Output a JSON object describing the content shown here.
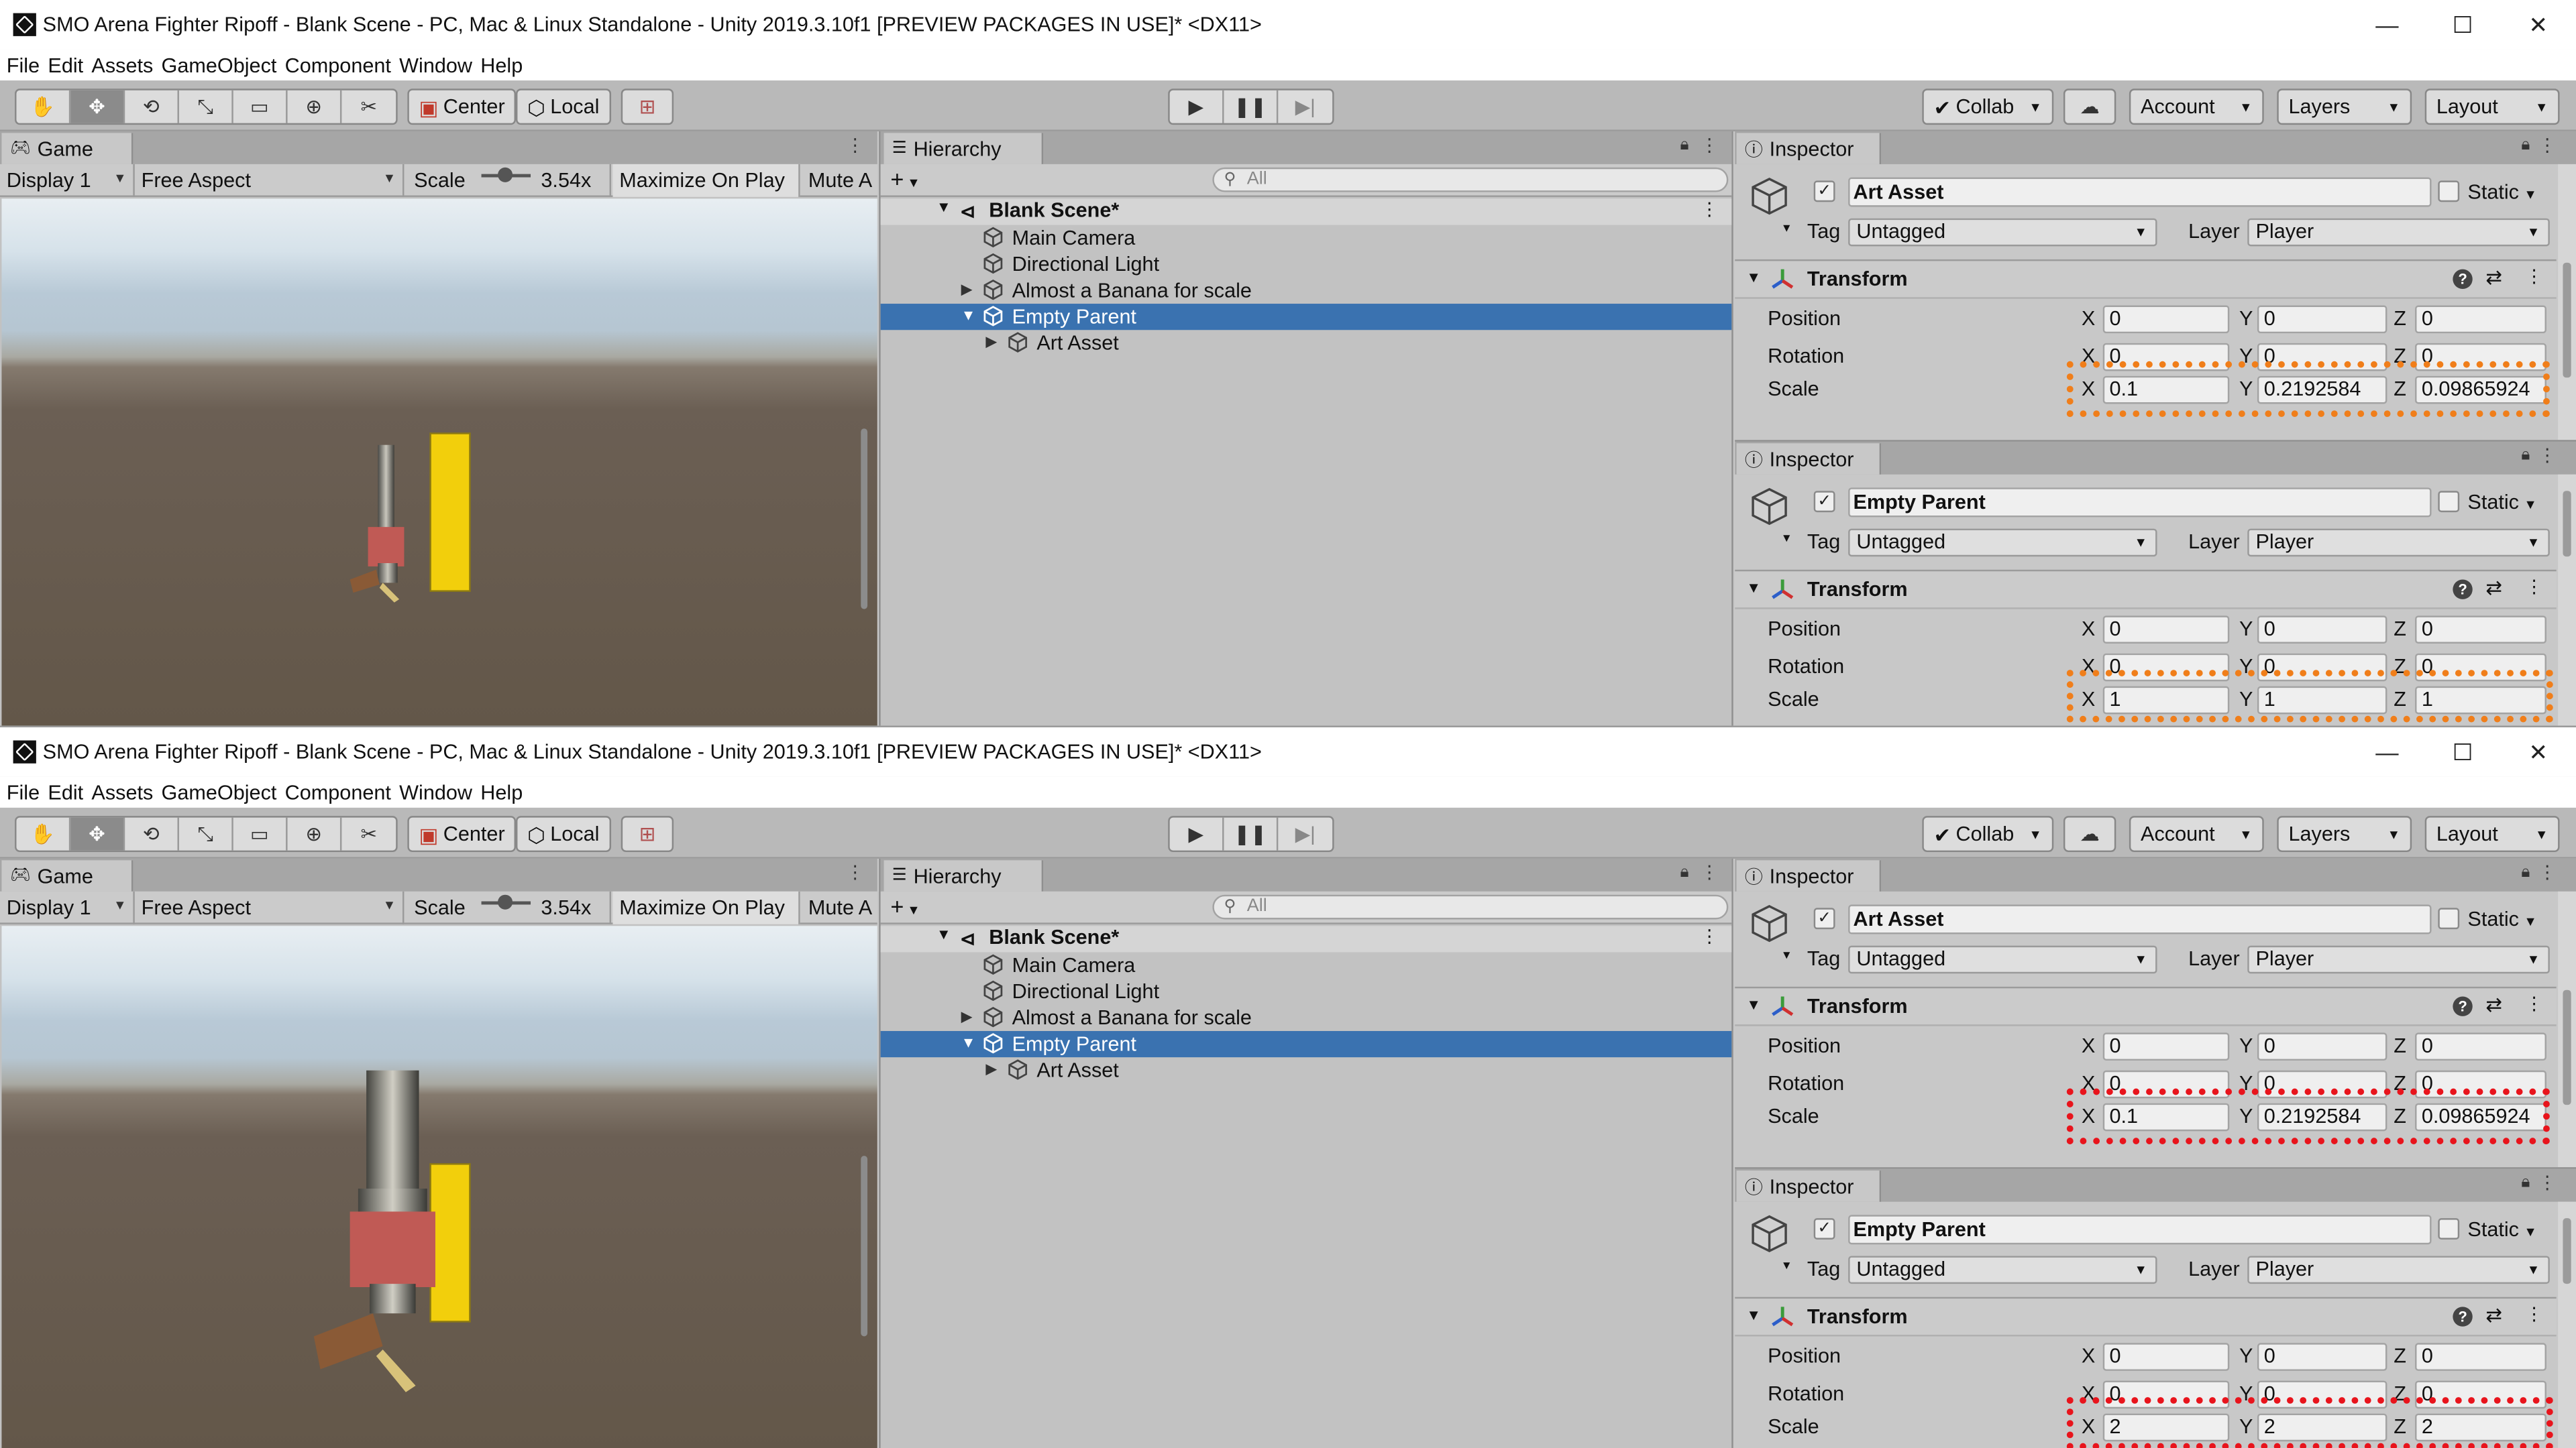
{
  "window": {
    "title": "SMO Arena Fighter Ripoff - Blank Scene - PC, Mac & Linux Standalone - Unity 2019.3.10f1 [PREVIEW PACKAGES IN USE]* <DX11>",
    "minimize": "—",
    "maximize": "☐",
    "close": "✕"
  },
  "menu": [
    "File",
    "Edit",
    "Assets",
    "GameObject",
    "Component",
    "Window",
    "Help"
  ],
  "toolbar": {
    "pivot": "Center",
    "space": "Local",
    "collab": "Collab",
    "account": "Account",
    "layers": "Layers",
    "layout": "Layout"
  },
  "game": {
    "tab": "Game",
    "display": "Display 1",
    "aspect": "Free Aspect",
    "scale_label": "Scale",
    "scale_value": "3.54x",
    "maximize": "Maximize On Play",
    "mute": "Mute A"
  },
  "hierarchy": {
    "tab": "Hierarchy",
    "search_placeholder": "All",
    "scene": "Blank Scene*",
    "items": [
      "Main Camera",
      "Directional Light",
      "Almost a Banana for scale",
      "Empty Parent",
      "Art Asset"
    ]
  },
  "inspector": {
    "tab": "Inspector",
    "static": "Static",
    "tag_label": "Tag",
    "tag": "Untagged",
    "layer_label": "Layer",
    "layer": "Player",
    "component": "Transform",
    "position": "Position",
    "rotation": "Rotation",
    "scale": "Scale"
  },
  "panels": [
    {
      "art": {
        "name": "Art Asset",
        "position": [
          "0",
          "0",
          "0"
        ],
        "rotation": [
          "0",
          "0",
          "0"
        ],
        "scale": [
          "0.1",
          "0.2192584",
          "0.09865924"
        ]
      },
      "parent": {
        "name": "Empty Parent",
        "position": [
          "0",
          "0",
          "0"
        ],
        "rotation": [
          "0",
          "0",
          "0"
        ],
        "scale": [
          "1",
          "1",
          "1"
        ]
      },
      "highlight_color": "#f07e1a"
    },
    {
      "art": {
        "name": "Art Asset",
        "position": [
          "0",
          "0",
          "0"
        ],
        "rotation": [
          "0",
          "0",
          "0"
        ],
        "scale": [
          "0.1",
          "0.2192584",
          "0.09865924"
        ]
      },
      "parent": {
        "name": "Empty Parent",
        "position": [
          "0",
          "0",
          "0"
        ],
        "rotation": [
          "0",
          "0",
          "0"
        ],
        "scale": [
          "2",
          "2",
          "2"
        ]
      },
      "highlight_color": "#e8141c"
    }
  ],
  "colors": {
    "selection": "#3a72b0",
    "banana": "#f2cf0c",
    "handle_red": "#c05a55"
  }
}
